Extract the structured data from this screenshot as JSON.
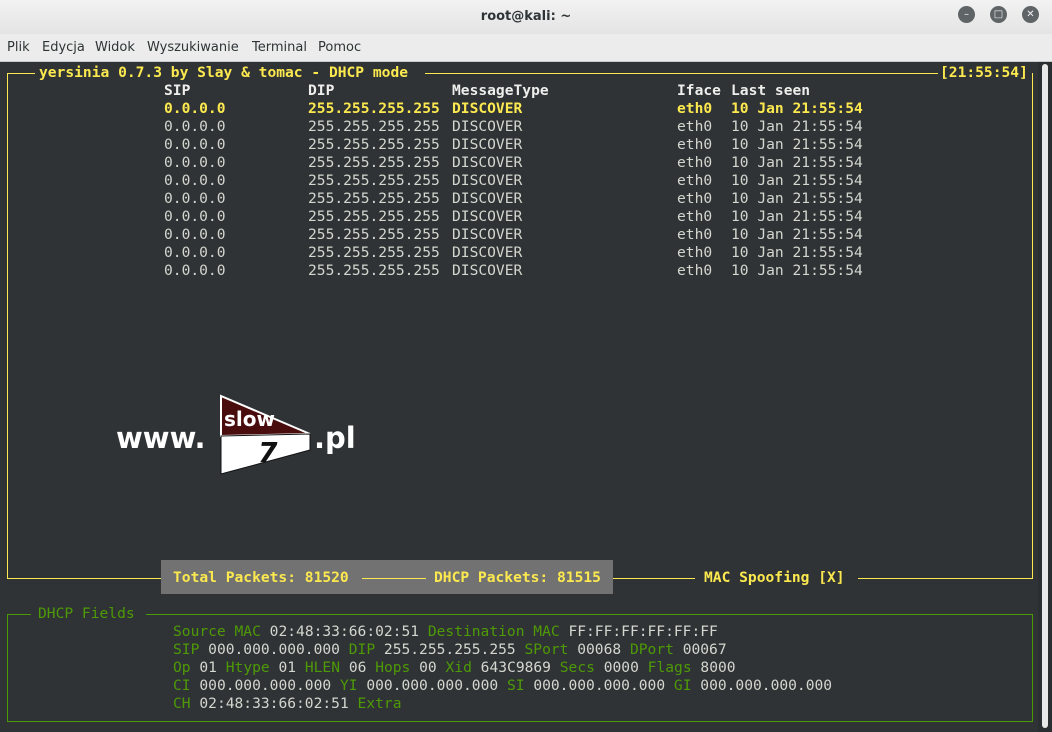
{
  "window": {
    "title": "root@kali: ~"
  },
  "menu": [
    "Plik",
    "Edycja",
    "Widok",
    "Wyszukiwanie",
    "Terminal",
    "Pomoc"
  ],
  "header": {
    "title": "yersinia 0.7.3 by Slay & tomac - DHCP mode",
    "clock": "[21:55:54]"
  },
  "columns": {
    "sip": "SIP",
    "dip": "DIP",
    "msg": "MessageType",
    "iface": "Iface",
    "seen": "Last seen"
  },
  "rows": [
    {
      "sip": "0.0.0.0",
      "dip": "255.255.255.255",
      "msg": "DISCOVER",
      "iface": "eth0",
      "seen": "10 Jan 21:55:54"
    },
    {
      "sip": "0.0.0.0",
      "dip": "255.255.255.255",
      "msg": "DISCOVER",
      "iface": "eth0",
      "seen": "10 Jan 21:55:54"
    },
    {
      "sip": "0.0.0.0",
      "dip": "255.255.255.255",
      "msg": "DISCOVER",
      "iface": "eth0",
      "seen": "10 Jan 21:55:54"
    },
    {
      "sip": "0.0.0.0",
      "dip": "255.255.255.255",
      "msg": "DISCOVER",
      "iface": "eth0",
      "seen": "10 Jan 21:55:54"
    },
    {
      "sip": "0.0.0.0",
      "dip": "255.255.255.255",
      "msg": "DISCOVER",
      "iface": "eth0",
      "seen": "10 Jan 21:55:54"
    },
    {
      "sip": "0.0.0.0",
      "dip": "255.255.255.255",
      "msg": "DISCOVER",
      "iface": "eth0",
      "seen": "10 Jan 21:55:54"
    },
    {
      "sip": "0.0.0.0",
      "dip": "255.255.255.255",
      "msg": "DISCOVER",
      "iface": "eth0",
      "seen": "10 Jan 21:55:54"
    },
    {
      "sip": "0.0.0.0",
      "dip": "255.255.255.255",
      "msg": "DISCOVER",
      "iface": "eth0",
      "seen": "10 Jan 21:55:54"
    },
    {
      "sip": "0.0.0.0",
      "dip": "255.255.255.255",
      "msg": "DISCOVER",
      "iface": "eth0",
      "seen": "10 Jan 21:55:54"
    },
    {
      "sip": "0.0.0.0",
      "dip": "255.255.255.255",
      "msg": "DISCOVER",
      "iface": "eth0",
      "seen": "10 Jan 21:55:54"
    }
  ],
  "status": {
    "total": "Total Packets: 81520",
    "dhcp": "DHCP Packets: 81515",
    "mac": "MAC Spoofing [X]"
  },
  "fields": {
    "title": "DHCP Fields",
    "lines": [
      [
        {
          "l": "Source MAC",
          "v": "02:48:33:66:02:51"
        },
        {
          "l": "Destination MAC",
          "v": "FF:FF:FF:FF:FF:FF"
        }
      ],
      [
        {
          "l": "SIP",
          "v": "000.000.000.000"
        },
        {
          "l": "DIP",
          "v": "255.255.255.255"
        },
        {
          "l": "SPort",
          "v": "00068"
        },
        {
          "l": "DPort",
          "v": "00067"
        }
      ],
      [
        {
          "l": "Op",
          "v": "01"
        },
        {
          "l": "Htype",
          "v": "01"
        },
        {
          "l": "HLEN",
          "v": "06"
        },
        {
          "l": "Hops",
          "v": "00"
        },
        {
          "l": "Xid",
          "v": "643C9869"
        },
        {
          "l": "Secs",
          "v": "0000"
        },
        {
          "l": "Flags",
          "v": "8000"
        }
      ],
      [
        {
          "l": "CI",
          "v": "000.000.000.000"
        },
        {
          "l": "YI",
          "v": "000.000.000.000"
        },
        {
          "l": "SI",
          "v": "000.000.000.000"
        },
        {
          "l": "GI",
          "v": "000.000.000.000"
        }
      ],
      [
        {
          "l": "CH",
          "v": "02:48:33:66:02:51"
        },
        {
          "l": "Extra",
          "v": ""
        }
      ]
    ]
  },
  "watermark": {
    "prefix": "www.",
    "badge_top": "slow",
    "badge_num": "7",
    "suffix": ".pl"
  },
  "icons": {
    "minimize": "minimize-icon",
    "maximize": "maximize-icon",
    "close": "close-icon"
  }
}
